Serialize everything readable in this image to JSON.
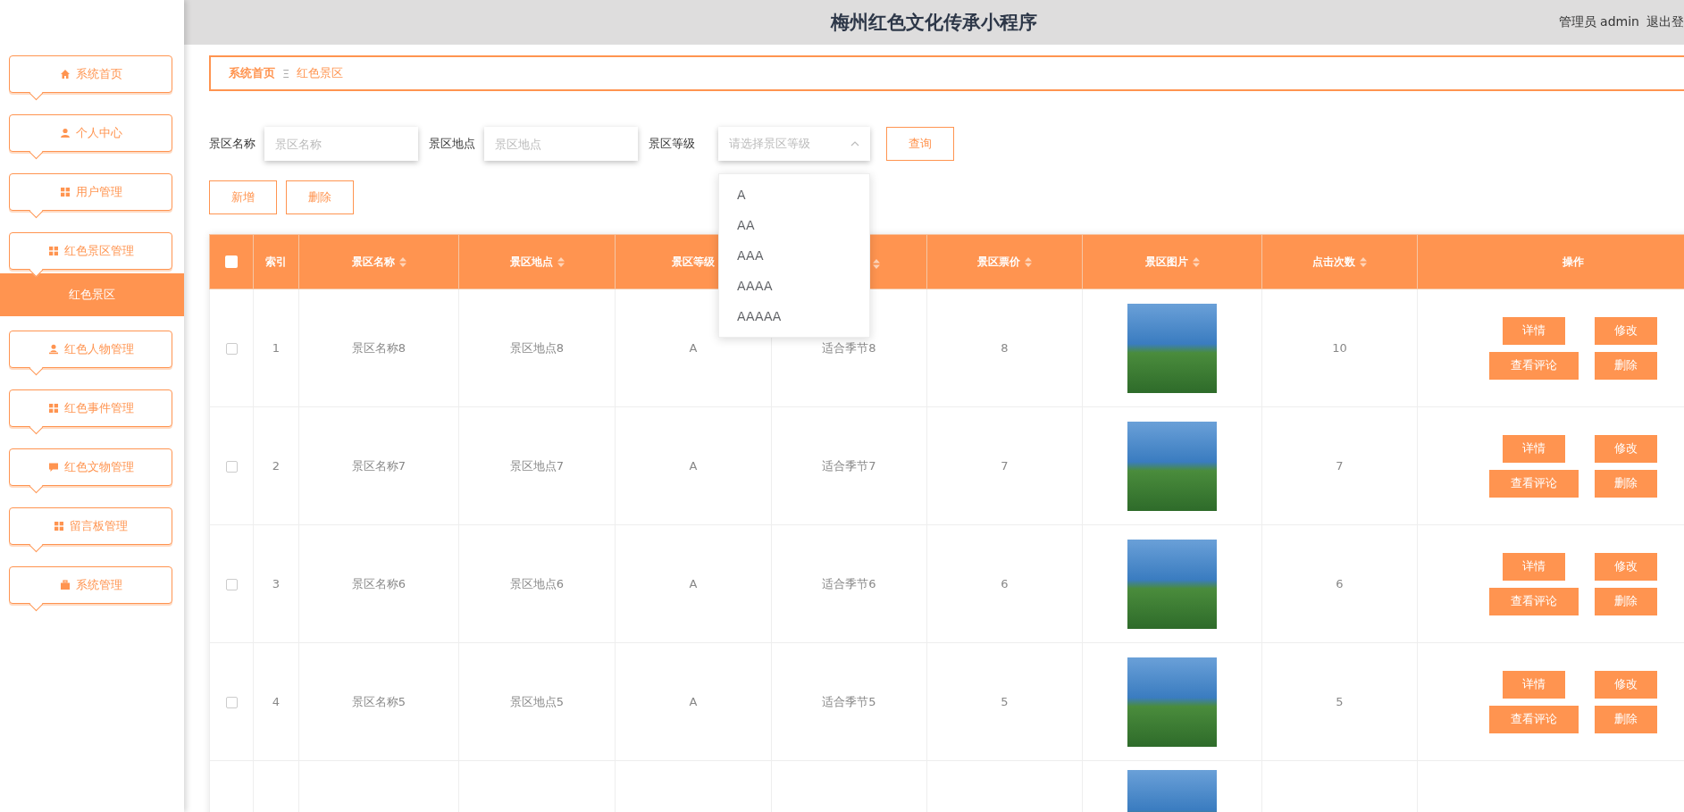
{
  "header": {
    "title": "梅州红色文化传承小程序",
    "user": "管理员 admin",
    "logout": "退出登"
  },
  "sidebar": {
    "items": [
      {
        "label": "系统首页",
        "kind": "home"
      },
      {
        "label": "个人中心",
        "kind": "person"
      },
      {
        "label": "用户管理",
        "kind": "grid"
      },
      {
        "label": "红色景区管理",
        "kind": "grid",
        "children": [
          {
            "label": "红色景区",
            "selected": true
          }
        ]
      },
      {
        "label": "红色人物管理",
        "kind": "bust"
      },
      {
        "label": "红色事件管理",
        "kind": "grid"
      },
      {
        "label": "红色文物管理",
        "kind": "chat"
      },
      {
        "label": "留言板管理",
        "kind": "grid"
      },
      {
        "label": "系统管理",
        "kind": "briefcase"
      }
    ]
  },
  "breadcrumb": {
    "items": [
      "系统首页",
      "红色景区"
    ],
    "separator": "Ξ"
  },
  "search": {
    "fields": [
      {
        "kind": "input",
        "label": "景区名称",
        "placeholder": "景区名称"
      },
      {
        "kind": "input",
        "label": "景区地点",
        "placeholder": "景区地点"
      },
      {
        "kind": "select",
        "label": "景区等级",
        "placeholder": "请选择景区等级",
        "expanded": true,
        "options": [
          "A",
          "AA",
          "AAA",
          "AAAA",
          "AAAAA"
        ]
      }
    ],
    "query_button": "查询"
  },
  "actions": [
    "新增",
    "删除"
  ],
  "table": {
    "select_all": {
      "checked": false
    },
    "columns": [
      {
        "kind": "checkbox"
      },
      {
        "label": "索引",
        "kind": "plain"
      },
      {
        "label": "景区名称",
        "kind": "sortable"
      },
      {
        "label": "景区地点",
        "kind": "sortable"
      },
      {
        "label": "景区等级",
        "kind": "plain"
      },
      {
        "kind": "sortable"
      },
      {
        "label": "景区票价",
        "kind": "sortable"
      },
      {
        "label": "景区图片",
        "kind": "sortable"
      },
      {
        "label": "点击次数",
        "kind": "sortable"
      },
      {
        "label": "操作",
        "kind": "plain"
      }
    ],
    "rows": [
      {
        "checked": false,
        "cells": [
          "1",
          "景区名称8",
          "景区地点8",
          "A",
          "适合季节8",
          "8"
        ],
        "clicks": "10",
        "buttons": [
          "详情",
          "修改",
          "查看评论",
          "删除"
        ]
      },
      {
        "checked": false,
        "cells": [
          "2",
          "景区名称7",
          "景区地点7",
          "A",
          "适合季节7",
          "7"
        ],
        "clicks": "7",
        "buttons": [
          "详情",
          "修改",
          "查看评论",
          "删除"
        ]
      },
      {
        "checked": false,
        "cells": [
          "3",
          "景区名称6",
          "景区地点6",
          "A",
          "适合季节6",
          "6"
        ],
        "clicks": "6",
        "buttons": [
          "详情",
          "修改",
          "查看评论",
          "删除"
        ]
      },
      {
        "checked": false,
        "cells": [
          "4",
          "景区名称5",
          "景区地点5",
          "A",
          "适合季节5",
          "5"
        ],
        "clicks": "5",
        "buttons": [
          "详情",
          "修改",
          "查看评论",
          "删除"
        ]
      },
      {}
    ]
  }
}
